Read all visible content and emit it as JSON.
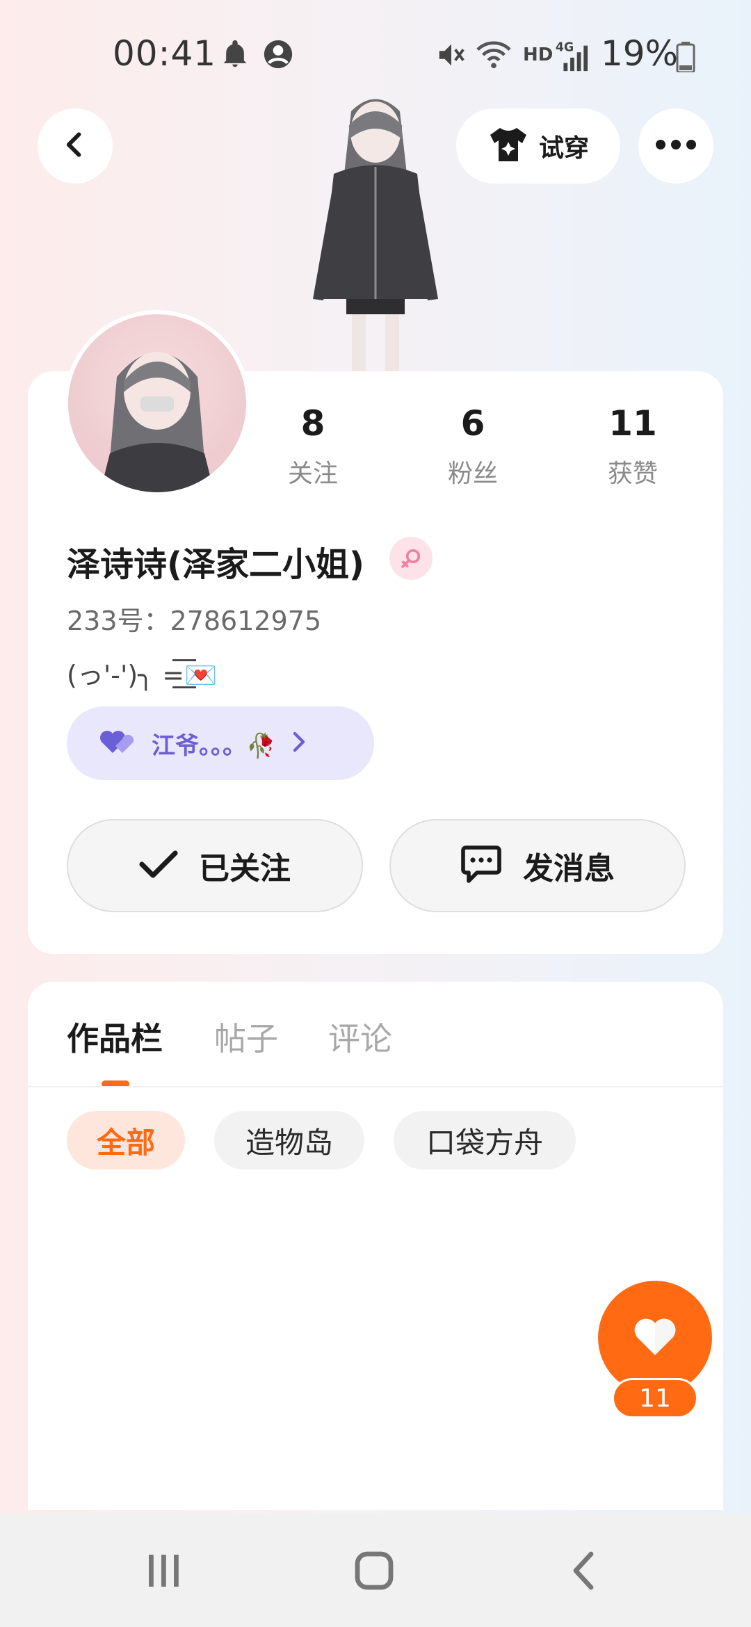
{
  "status_bar": {
    "time": "00:41",
    "battery": "19%",
    "icons": [
      "bell-icon",
      "account-circle-icon",
      "mute-icon",
      "wifi-icon",
      "hd-icon",
      "4g-signal-icon",
      "battery-icon"
    ],
    "hd_label": "HD",
    "network_label": "4G"
  },
  "header": {
    "back_icon": "chevron-left-icon",
    "tryon_label": "试穿",
    "tryon_icon": "tshirt-icon",
    "more_icon": "more-horizontal-icon"
  },
  "profile": {
    "stats": [
      {
        "value": "8",
        "label": "关注"
      },
      {
        "value": "6",
        "label": "粉丝"
      },
      {
        "value": "11",
        "label": "获赞"
      }
    ],
    "nickname": "泽诗诗(泽家二小姐)",
    "gender_icon": "female-icon",
    "user_id": "233号：278612975",
    "signature": "(っ'-')╮ =͟͟͞͞💌",
    "bond": {
      "icon": "double-heart-icon",
      "name": "江爷。。。🥀"
    },
    "follow_button": "已关注",
    "message_button": "发消息"
  },
  "works": {
    "tabs": [
      "作品栏",
      "帖子",
      "评论"
    ],
    "active_tab": 0,
    "chips": [
      "全部",
      "造物岛",
      "口袋方舟"
    ],
    "active_chip": 0
  },
  "like_fab": {
    "count": "11",
    "icon": "heart-icon"
  },
  "colors": {
    "accent": "#ff6a13",
    "bond_bg": "#e9e7fb",
    "bond_text": "#6b5fd6"
  }
}
